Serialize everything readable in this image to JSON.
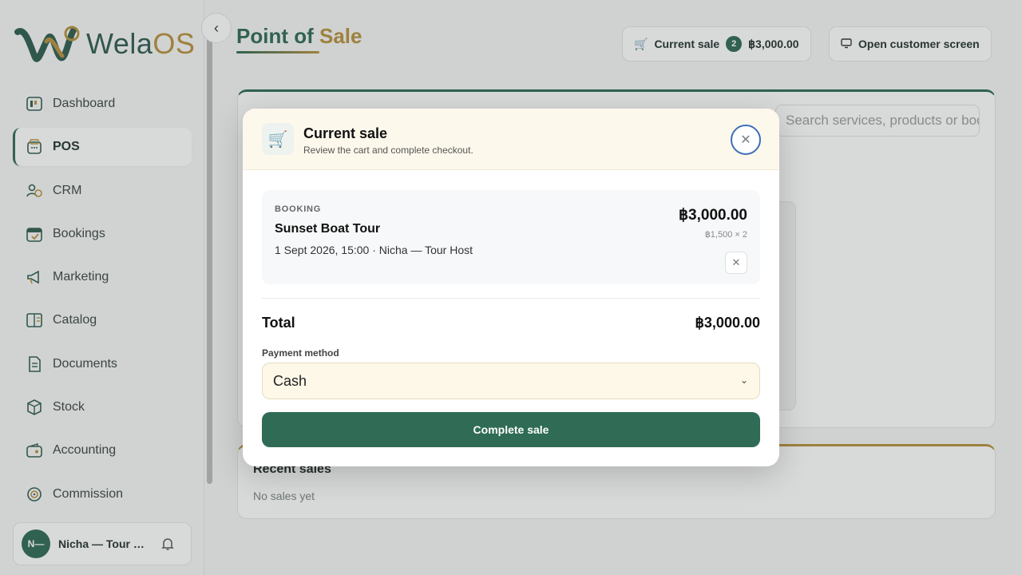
{
  "brand": {
    "name_part1": "Wela",
    "name_part2": "OS",
    "primary_color": "#2f6b55",
    "accent_color": "#b7913e"
  },
  "sidebar": {
    "items": [
      {
        "label": "Dashboard",
        "icon": "dashboard-icon"
      },
      {
        "label": "POS",
        "icon": "pos-icon",
        "active": true
      },
      {
        "label": "CRM",
        "icon": "crm-icon"
      },
      {
        "label": "Bookings",
        "icon": "calendar-icon"
      },
      {
        "label": "Marketing",
        "icon": "megaphone-icon"
      },
      {
        "label": "Catalog",
        "icon": "catalog-icon"
      },
      {
        "label": "Documents",
        "icon": "document-icon"
      },
      {
        "label": "Stock",
        "icon": "box-icon"
      },
      {
        "label": "Accounting",
        "icon": "wallet-icon"
      },
      {
        "label": "Commission",
        "icon": "target-icon"
      }
    ],
    "user": {
      "initials": "N—",
      "name": "Nicha — Tour Host"
    }
  },
  "header": {
    "title_part1": "Point of ",
    "title_part2": "Sale",
    "current_sale_label": "Current sale",
    "current_sale_count": "2",
    "current_sale_total": "฿3,000.00",
    "customer_screen_label": "Open customer screen"
  },
  "catalog": {
    "search_placeholder": "Search services, products or bookings"
  },
  "recent_sales": {
    "title": "Recent sales",
    "empty": "No sales yet"
  },
  "modal": {
    "title": "Current sale",
    "subtitle": "Review the cart and complete checkout.",
    "item": {
      "type": "BOOKING",
      "name": "Sunset Boat Tour",
      "detail": "1 Sept 2026, 15:00 · Nicha — Tour Host",
      "price": "฿3,000.00",
      "qty": "฿1,500 × 2"
    },
    "total_label": "Total",
    "total_value": "฿3,000.00",
    "payment_label": "Payment method",
    "payment_value": "Cash",
    "complete_label": "Complete sale"
  }
}
